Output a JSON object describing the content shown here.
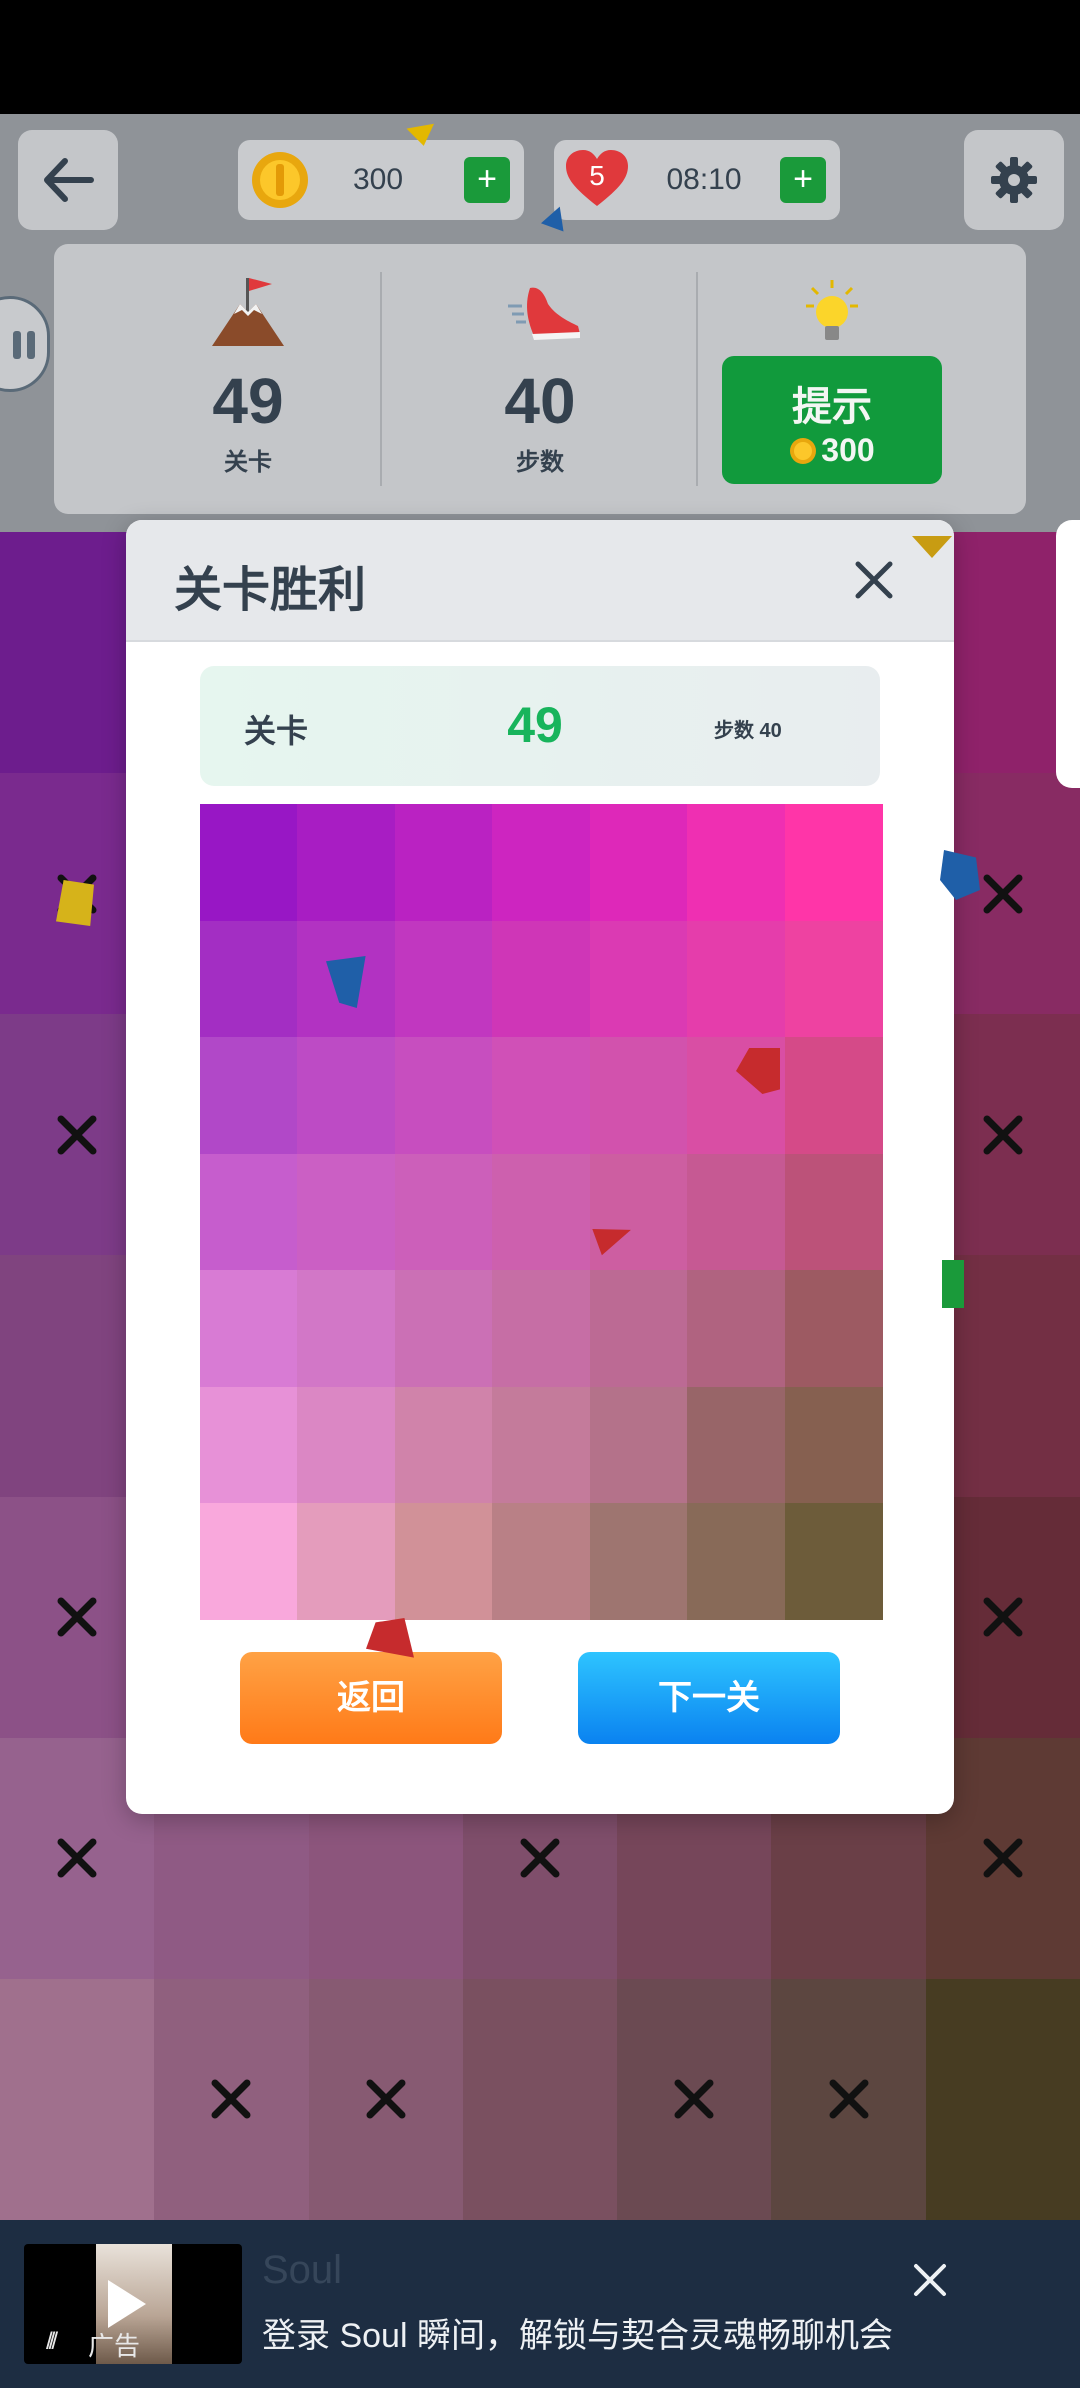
{
  "header": {
    "coins": "300",
    "lives": "5",
    "timer": "08:10",
    "plus_label": "+"
  },
  "stats": {
    "level_value": "49",
    "level_label": "关卡",
    "steps_value": "40",
    "steps_label": "步数",
    "hint_label": "提示",
    "hint_cost": "300"
  },
  "dialog": {
    "title": "关卡胜利",
    "info_label": "关卡",
    "info_level": "49",
    "info_steps": "步数 40",
    "return_label": "返回",
    "next_label": "下一关"
  },
  "palette_colors": [
    [
      "#9817c5",
      "#a81dc3",
      "#ba22c2",
      "#cd25c0",
      "#de28b9",
      "#ef2fb2",
      "#ff35a8"
    ],
    [
      "#a32ec3",
      "#b232c2",
      "#c137c0",
      "#cf36b7",
      "#db3ab3",
      "#e53dab",
      "#ee42a1"
    ],
    [
      "#b148c8",
      "#bd4bc5",
      "#c74ebf",
      "#d050b7",
      "#d252ad",
      "#d94ea4",
      "#d54a88"
    ],
    [
      "#c65dcd",
      "#cb5fc4",
      "#cc5fba",
      "#cd60ae",
      "#cd5ea1",
      "#c65993",
      "#bc5279"
    ],
    [
      "#d87bd4",
      "#d277c7",
      "#cb70b5",
      "#c66ea5",
      "#bc6a94",
      "#b06380",
      "#9d5a62"
    ],
    [
      "#e791d7",
      "#db87c4",
      "#d083aa",
      "#c47b9b",
      "#b4728a",
      "#986568",
      "#866050"
    ],
    [
      "#f9a8dc",
      "#e49cbc",
      "#d19198",
      "#b98086",
      "#9e7570",
      "#886a58",
      "#6d5c3a"
    ]
  ],
  "board_colors": [
    [
      "#6d1d8d",
      "#87239c",
      "#9b2ba4",
      "#ad309f",
      "#b13596",
      "#a5307e",
      "#8f226a"
    ],
    [
      "#7a2a8e",
      "#8c3198",
      "#9e3799",
      "#ab3893",
      "#a9388a",
      "#9c337a",
      "#882b63"
    ],
    [
      "#7d3b88",
      "#8a3f8d",
      "#984390",
      "#a14485",
      "#a03f78",
      "#95386a",
      "#7c2e50"
    ],
    [
      "#80447f",
      "#8a4983",
      "#934b80",
      "#974e7b",
      "#914970",
      "#85415e",
      "#732f44"
    ],
    [
      "#8c5187",
      "#905387",
      "#955182",
      "#8f4d74",
      "#874663",
      "#7a3d4e",
      "#652c38"
    ],
    [
      "#96628e",
      "#8f5a84",
      "#8c557c",
      "#7f4e6b",
      "#76465a",
      "#6a3f47",
      "#5e3a34"
    ],
    [
      "#a0708d",
      "#90607e",
      "#875a72",
      "#7a5060",
      "#6b4a52",
      "#5c4640",
      "#473c22"
    ]
  ],
  "ad": {
    "title": "Soul",
    "text": "登录 Soul 瞬间，解锁与契合灵魂畅聊机会",
    "tag": "广告"
  }
}
